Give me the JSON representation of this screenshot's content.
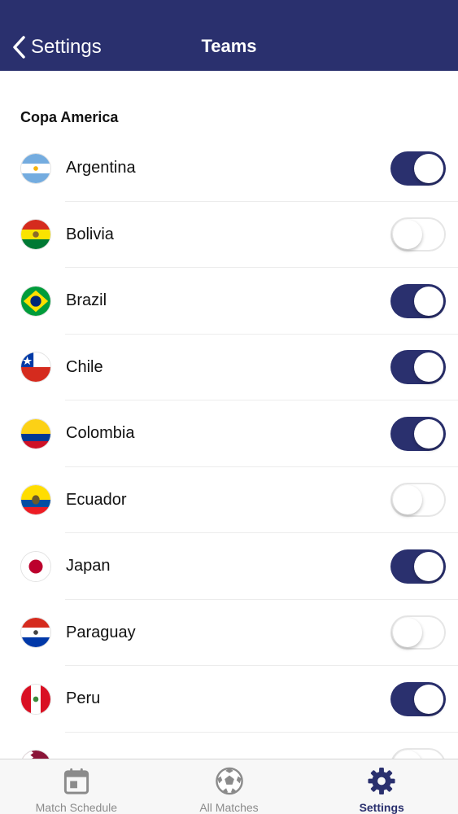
{
  "nav": {
    "back_label": "Settings",
    "title": "Teams"
  },
  "section": {
    "title": "Copa America"
  },
  "teams": [
    {
      "name": "Argentina",
      "enabled": true,
      "flag": "argentina-flag"
    },
    {
      "name": "Bolivia",
      "enabled": false,
      "flag": "bolivia-flag"
    },
    {
      "name": "Brazil",
      "enabled": true,
      "flag": "brazil-flag"
    },
    {
      "name": "Chile",
      "enabled": true,
      "flag": "chile-flag"
    },
    {
      "name": "Colombia",
      "enabled": true,
      "flag": "colombia-flag"
    },
    {
      "name": "Ecuador",
      "enabled": false,
      "flag": "ecuador-flag"
    },
    {
      "name": "Japan",
      "enabled": true,
      "flag": "japan-flag"
    },
    {
      "name": "Paraguay",
      "enabled": false,
      "flag": "paraguay-flag"
    },
    {
      "name": "Peru",
      "enabled": true,
      "flag": "peru-flag"
    },
    {
      "name": "",
      "enabled": false,
      "flag": "qatar-flag"
    }
  ],
  "tabs": [
    {
      "label": "Match Schedule",
      "icon": "calendar-icon",
      "active": false
    },
    {
      "label": "All Matches",
      "icon": "soccer-ball-icon",
      "active": false
    },
    {
      "label": "Settings",
      "icon": "gear-icon",
      "active": true
    }
  ],
  "colors": {
    "nav": "#2a306e",
    "toggle_on": "#2a306e",
    "tab_inactive": "#8b8b8b"
  }
}
